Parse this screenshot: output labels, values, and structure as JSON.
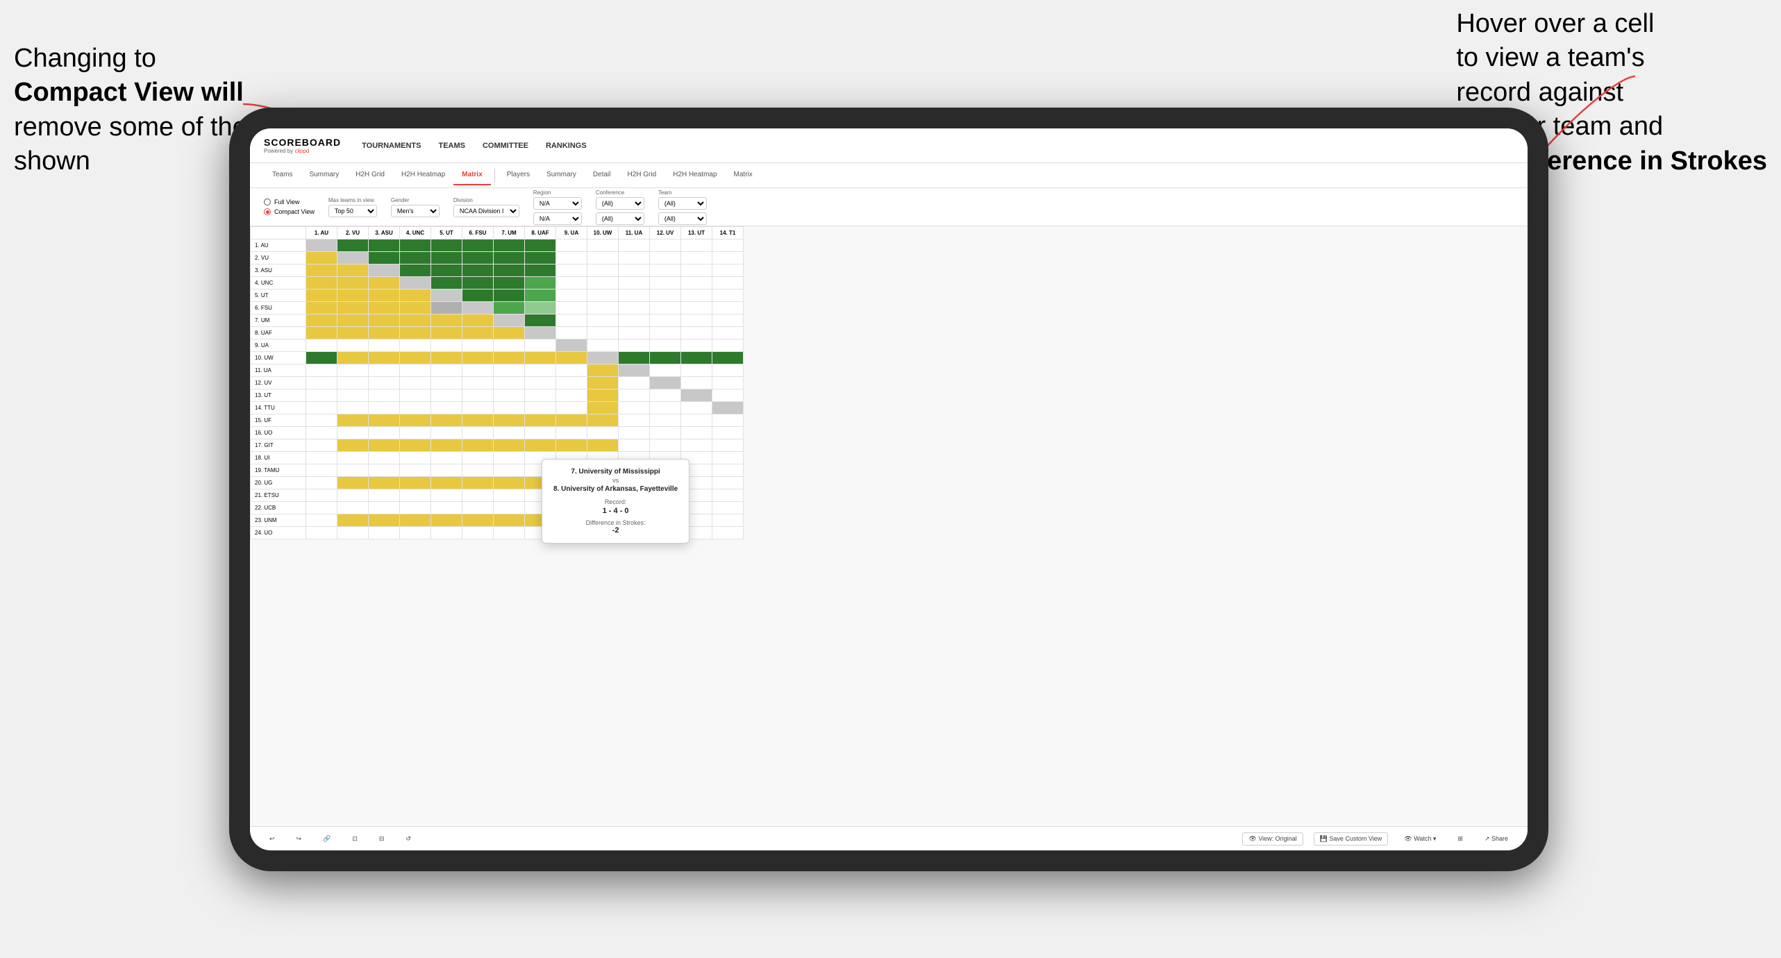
{
  "annotations": {
    "left_text_line1": "Changing to",
    "left_text_bold": "Compact View will",
    "left_text_rest": "remove some of the initial data shown",
    "right_text_line1": "Hover over a cell",
    "right_text_line2": "to view a team's",
    "right_text_line3": "record against",
    "right_text_line4": "another team and",
    "right_text_bold": "the Difference in Strokes"
  },
  "app": {
    "logo": "SCOREBOARD",
    "logo_sub": "Powered by clippd",
    "nav_items": [
      "TOURNAMENTS",
      "TEAMS",
      "COMMITTEE",
      "RANKINGS"
    ]
  },
  "secondary_tabs_left": [
    "Teams",
    "Summary",
    "H2H Grid",
    "H2H Heatmap",
    "Matrix"
  ],
  "secondary_tabs_right": [
    "Players",
    "Summary",
    "Detail",
    "H2H Grid",
    "H2H Heatmap",
    "Matrix"
  ],
  "active_tab": "Matrix",
  "controls": {
    "view_full": "Full View",
    "view_compact": "Compact View",
    "filters": [
      {
        "label": "Max teams in view",
        "value": "Top 50"
      },
      {
        "label": "Gender",
        "value": "Men's"
      },
      {
        "label": "Division",
        "value": "NCAA Division I"
      },
      {
        "label": "Region",
        "value": "N/A"
      },
      {
        "label": "Conference",
        "value": "(All)"
      },
      {
        "label": "Team",
        "value": "(All)"
      }
    ]
  },
  "matrix": {
    "col_headers": [
      "1. AU",
      "2. VU",
      "3. ASU",
      "4. UNC",
      "5. UT",
      "6. FSU",
      "7. UM",
      "8. UAF",
      "9. UA",
      "10. UW",
      "11. UA",
      "12. UV",
      "13. UT",
      "14. T"
    ],
    "rows": [
      {
        "label": "1. AU",
        "cells": [
          "diag",
          "green-dark",
          "green-dark",
          "green-dark",
          "green-dark",
          "green-dark",
          "green-dark",
          "green-dark",
          "white",
          "white",
          "white",
          "white",
          "white",
          "white"
        ]
      },
      {
        "label": "2. VU",
        "cells": [
          "yellow",
          "diag",
          "green-dark",
          "green-dark",
          "green-dark",
          "green-dark",
          "green-dark",
          "green-dark",
          "white",
          "white",
          "white",
          "white",
          "white",
          "white"
        ]
      },
      {
        "label": "3. ASU",
        "cells": [
          "yellow",
          "yellow",
          "diag",
          "green-dark",
          "green-dark",
          "green-dark",
          "green-dark",
          "green-dark",
          "white",
          "white",
          "white",
          "white",
          "white",
          "white"
        ]
      },
      {
        "label": "4. UNC",
        "cells": [
          "yellow",
          "yellow",
          "yellow",
          "diag",
          "green-dark",
          "green-dark",
          "green-dark",
          "green-med",
          "white",
          "white",
          "white",
          "white",
          "white",
          "white"
        ]
      },
      {
        "label": "5. UT",
        "cells": [
          "yellow",
          "yellow",
          "yellow",
          "yellow",
          "diag",
          "green-dark",
          "green-dark",
          "green-med",
          "white",
          "white",
          "white",
          "white",
          "white",
          "white"
        ]
      },
      {
        "label": "6. FSU",
        "cells": [
          "yellow",
          "yellow",
          "yellow",
          "yellow",
          "gray",
          "diag",
          "green-med",
          "green-light",
          "white",
          "white",
          "white",
          "white",
          "white",
          "white"
        ]
      },
      {
        "label": "7. UM",
        "cells": [
          "yellow",
          "yellow",
          "yellow",
          "yellow",
          "yellow",
          "yellow",
          "diag",
          "green-dark",
          "white",
          "white",
          "white",
          "white",
          "white",
          "white"
        ]
      },
      {
        "label": "8. UAF",
        "cells": [
          "yellow",
          "yellow",
          "yellow",
          "yellow",
          "yellow",
          "yellow",
          "yellow",
          "diag",
          "white",
          "white",
          "white",
          "white",
          "white",
          "white"
        ]
      },
      {
        "label": "9. UA",
        "cells": [
          "white",
          "white",
          "white",
          "white",
          "white",
          "white",
          "white",
          "white",
          "diag",
          "white",
          "white",
          "white",
          "white",
          "white"
        ]
      },
      {
        "label": "10. UW",
        "cells": [
          "green-dark",
          "yellow",
          "yellow",
          "yellow",
          "yellow",
          "yellow",
          "yellow",
          "yellow",
          "yellow",
          "diag",
          "green-dark",
          "green-dark",
          "green-dark",
          "green-dark"
        ]
      },
      {
        "label": "11. UA",
        "cells": [
          "white",
          "white",
          "white",
          "white",
          "white",
          "white",
          "white",
          "white",
          "white",
          "yellow",
          "diag",
          "white",
          "white",
          "white"
        ]
      },
      {
        "label": "12. UV",
        "cells": [
          "white",
          "white",
          "white",
          "white",
          "white",
          "white",
          "white",
          "white",
          "white",
          "yellow",
          "white",
          "diag",
          "white",
          "white"
        ]
      },
      {
        "label": "13. UT",
        "cells": [
          "white",
          "white",
          "white",
          "white",
          "white",
          "white",
          "white",
          "white",
          "white",
          "yellow",
          "white",
          "white",
          "diag",
          "white"
        ]
      },
      {
        "label": "14. TTU",
        "cells": [
          "white",
          "white",
          "white",
          "white",
          "white",
          "white",
          "white",
          "white",
          "white",
          "yellow",
          "white",
          "white",
          "white",
          "diag"
        ]
      },
      {
        "label": "15. UF",
        "cells": [
          "white",
          "yellow",
          "yellow",
          "yellow",
          "yellow",
          "yellow",
          "yellow",
          "yellow",
          "yellow",
          "yellow",
          "white",
          "white",
          "white",
          "white"
        ]
      },
      {
        "label": "16. UO",
        "cells": [
          "white",
          "white",
          "white",
          "white",
          "white",
          "white",
          "white",
          "white",
          "white",
          "white",
          "white",
          "white",
          "white",
          "white"
        ]
      },
      {
        "label": "17. GIT",
        "cells": [
          "white",
          "yellow",
          "yellow",
          "yellow",
          "yellow",
          "yellow",
          "yellow",
          "yellow",
          "yellow",
          "yellow",
          "white",
          "white",
          "white",
          "white"
        ]
      },
      {
        "label": "18. UI",
        "cells": [
          "white",
          "white",
          "white",
          "white",
          "white",
          "white",
          "white",
          "white",
          "white",
          "white",
          "white",
          "white",
          "white",
          "white"
        ]
      },
      {
        "label": "19. TAMU",
        "cells": [
          "white",
          "white",
          "white",
          "white",
          "white",
          "white",
          "white",
          "white",
          "white",
          "white",
          "white",
          "white",
          "white",
          "white"
        ]
      },
      {
        "label": "20. UG",
        "cells": [
          "white",
          "yellow",
          "yellow",
          "yellow",
          "yellow",
          "yellow",
          "yellow",
          "yellow",
          "yellow",
          "yellow",
          "white",
          "white",
          "white",
          "white"
        ]
      },
      {
        "label": "21. ETSU",
        "cells": [
          "white",
          "white",
          "white",
          "white",
          "white",
          "white",
          "white",
          "white",
          "white",
          "white",
          "white",
          "white",
          "white",
          "white"
        ]
      },
      {
        "label": "22. UCB",
        "cells": [
          "white",
          "white",
          "white",
          "white",
          "white",
          "white",
          "white",
          "white",
          "white",
          "white",
          "white",
          "white",
          "white",
          "white"
        ]
      },
      {
        "label": "23. UNM",
        "cells": [
          "white",
          "yellow",
          "yellow",
          "yellow",
          "yellow",
          "yellow",
          "yellow",
          "yellow",
          "yellow",
          "yellow",
          "white",
          "white",
          "white",
          "white"
        ]
      },
      {
        "label": "24. UO",
        "cells": [
          "white",
          "white",
          "white",
          "white",
          "white",
          "white",
          "white",
          "white",
          "white",
          "white",
          "white",
          "white",
          "white",
          "white"
        ]
      }
    ]
  },
  "tooltip": {
    "team1": "7. University of Mississippi",
    "vs": "vs",
    "team2": "8. University of Arkansas, Fayetteville",
    "record_label": "Record:",
    "record": "1 - 4 - 0",
    "diff_label": "Difference in Strokes:",
    "diff": "-2"
  },
  "toolbar": {
    "undo": "↩",
    "redo": "↪",
    "view_original": "View: Original",
    "save_custom": "Save Custom View",
    "watch": "Watch",
    "share": "Share"
  }
}
